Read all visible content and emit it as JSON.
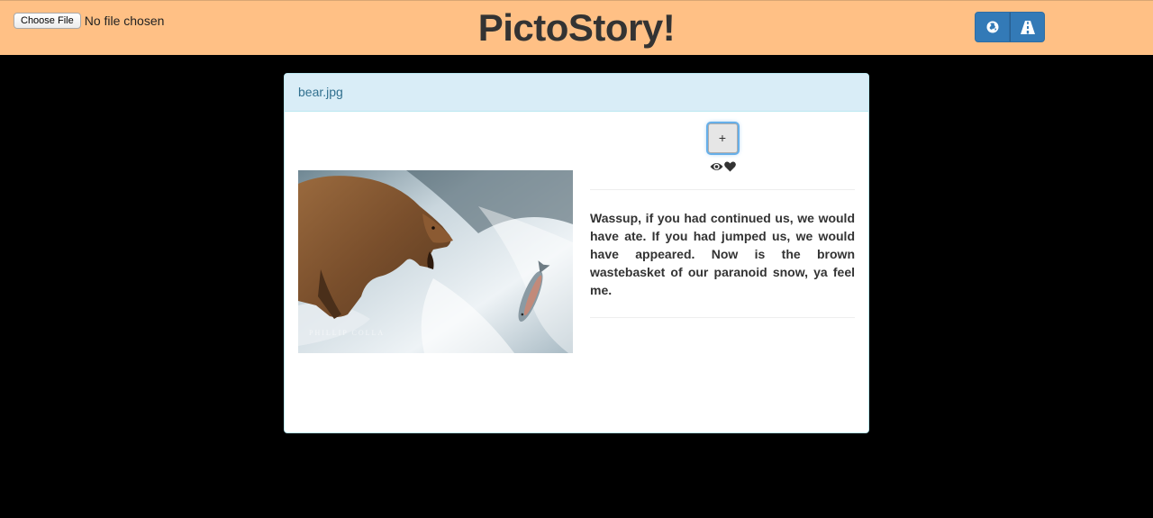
{
  "header": {
    "choose_file_label": "Choose File",
    "file_status": "No file chosen",
    "title": "PictoStory!",
    "buttons": [
      {
        "icon": "globe-icon"
      },
      {
        "icon": "road-icon"
      }
    ]
  },
  "panel": {
    "heading": "bear.jpg",
    "photo": {
      "subject": "brown bear catching a leaping salmon at a waterfall",
      "watermark": "PHILLIP COLLA"
    },
    "add_button_label": "+",
    "status_icons": [
      "eye-icon",
      "heart-icon"
    ],
    "story": "Wassup, if you had continued us, we would have ate. If you had jumped us, we would have appeared. Now is the brown wastebasket of our paranoid snow, ya feel me."
  },
  "colors": {
    "header_bg": "#ffc085",
    "page_bg": "#000000",
    "primary_button": "#337ab7",
    "panel_heading_bg": "#d9edf7",
    "panel_heading_text": "#31708f"
  }
}
